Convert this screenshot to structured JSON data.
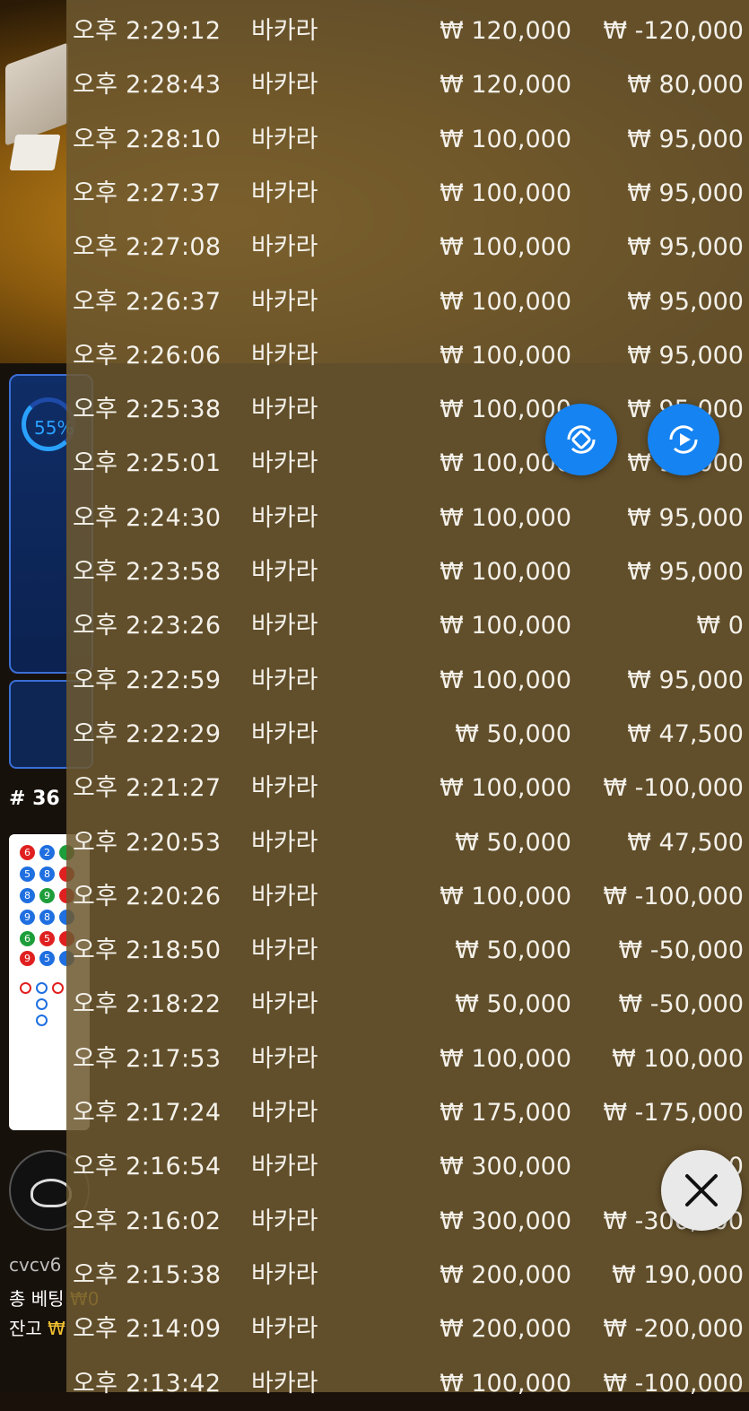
{
  "background": {
    "timer_percent": "55%",
    "shoe_label": "# 36",
    "user_id": "cvcv6",
    "total_bet_label": "총 베팅",
    "total_bet_value": "₩0",
    "balance_label": "잔고",
    "balance_value": "₩"
  },
  "history": {
    "rows": [
      {
        "time": "오후 2:29:12",
        "game": "바카라",
        "bet": "₩ 120,000",
        "win": "₩ -120,000"
      },
      {
        "time": "오후 2:28:43",
        "game": "바카라",
        "bet": "₩ 120,000",
        "win": "₩ 80,000"
      },
      {
        "time": "오후 2:28:10",
        "game": "바카라",
        "bet": "₩ 100,000",
        "win": "₩ 95,000"
      },
      {
        "time": "오후 2:27:37",
        "game": "바카라",
        "bet": "₩ 100,000",
        "win": "₩ 95,000"
      },
      {
        "time": "오후 2:27:08",
        "game": "바카라",
        "bet": "₩ 100,000",
        "win": "₩ 95,000"
      },
      {
        "time": "오후 2:26:37",
        "game": "바카라",
        "bet": "₩ 100,000",
        "win": "₩ 95,000"
      },
      {
        "time": "오후 2:26:06",
        "game": "바카라",
        "bet": "₩ 100,000",
        "win": "₩ 95,000"
      },
      {
        "time": "오후 2:25:38",
        "game": "바카라",
        "bet": "₩ 100,000",
        "win": "₩ 95,000"
      },
      {
        "time": "오후 2:25:01",
        "game": "바카라",
        "bet": "₩ 100,000",
        "win": "₩ 95,000"
      },
      {
        "time": "오후 2:24:30",
        "game": "바카라",
        "bet": "₩ 100,000",
        "win": "₩ 95,000"
      },
      {
        "time": "오후 2:23:58",
        "game": "바카라",
        "bet": "₩ 100,000",
        "win": "₩ 95,000"
      },
      {
        "time": "오후 2:23:26",
        "game": "바카라",
        "bet": "₩ 100,000",
        "win": "₩ 0"
      },
      {
        "time": "오후 2:22:59",
        "game": "바카라",
        "bet": "₩ 100,000",
        "win": "₩ 95,000"
      },
      {
        "time": "오후 2:22:29",
        "game": "바카라",
        "bet": "₩ 50,000",
        "win": "₩ 47,500"
      },
      {
        "time": "오후 2:21:27",
        "game": "바카라",
        "bet": "₩ 100,000",
        "win": "₩ -100,000"
      },
      {
        "time": "오후 2:20:53",
        "game": "바카라",
        "bet": "₩ 50,000",
        "win": "₩ 47,500"
      },
      {
        "time": "오후 2:20:26",
        "game": "바카라",
        "bet": "₩ 100,000",
        "win": "₩ -100,000"
      },
      {
        "time": "오후 2:18:50",
        "game": "바카라",
        "bet": "₩ 50,000",
        "win": "₩ -50,000"
      },
      {
        "time": "오후 2:18:22",
        "game": "바카라",
        "bet": "₩ 50,000",
        "win": "₩ -50,000"
      },
      {
        "time": "오후 2:17:53",
        "game": "바카라",
        "bet": "₩ 100,000",
        "win": "₩ 100,000"
      },
      {
        "time": "오후 2:17:24",
        "game": "바카라",
        "bet": "₩ 175,000",
        "win": "₩ -175,000"
      },
      {
        "time": "오후 2:16:54",
        "game": "바카라",
        "bet": "₩ 300,000",
        "win": "₩ 0"
      },
      {
        "time": "오후 2:16:02",
        "game": "바카라",
        "bet": "₩ 300,000",
        "win": "₩ -300,000"
      },
      {
        "time": "오후 2:15:38",
        "game": "바카라",
        "bet": "₩ 200,000",
        "win": "₩ 190,000"
      },
      {
        "time": "오후 2:14:09",
        "game": "바카라",
        "bet": "₩ 200,000",
        "win": "₩ -200,000"
      },
      {
        "time": "오후 2:13:42",
        "game": "바카라",
        "bet": "₩ 100,000",
        "win": "₩ -100,000"
      }
    ]
  },
  "buttons": {
    "rotate_icon": "screen-rotate-icon",
    "replay_icon": "replay-icon",
    "close_icon": "close-icon"
  },
  "colors": {
    "accent_blue": "#1583f2",
    "overlay": "#6e5830",
    "text": "#f4f1ea"
  }
}
